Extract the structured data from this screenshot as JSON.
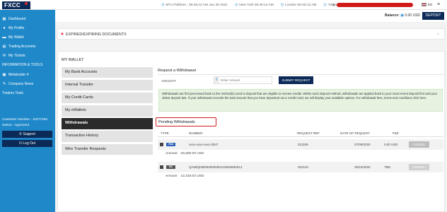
{
  "topbar": {
    "logo": "FXCC",
    "clocks": [
      {
        "label": "MT4 Platform : 06:46:12 AM  Jun 29 2021"
      },
      {
        "label": "New York  06:46:12 AM"
      },
      {
        "label": "London  06:46:12 AM"
      },
      {
        "label": "Tokyo  06:46:12 PM"
      }
    ],
    "user_prefix": "Ji",
    "language": "EN"
  },
  "sidebar": {
    "items": [
      {
        "label": "Dashboard",
        "icon": "dashboard-icon"
      },
      {
        "label": "My Profile",
        "icon": "profile-icon"
      },
      {
        "label": "My Wallet",
        "icon": "wallet-icon"
      },
      {
        "label": "Trading Accounts",
        "icon": "trading-accounts-icon"
      },
      {
        "label": "My Tickets",
        "icon": "tickets-icon"
      }
    ],
    "section_header": "INFORMATION & TOOLS",
    "tools": [
      {
        "label": "Metatrader 4",
        "icon": "metatrader-icon"
      },
      {
        "label": "Company News",
        "icon": "news-icon"
      },
      {
        "label": "Traders Tools",
        "icon": ""
      }
    ],
    "customer_number": "Customer Number :  11077262",
    "status": "Status : Approved",
    "support_label": "Support",
    "logout_label": "Log Out"
  },
  "balance": {
    "label": "Balance:",
    "value": "0.00 USD",
    "deposit_label": "DEPOSIT"
  },
  "expired": {
    "title": "EXPIRED/EXPIRING DOCUMENTS"
  },
  "wallet": {
    "title": "MY WALLET",
    "tabs": [
      {
        "label": "My Bank Accounts",
        "active": false
      },
      {
        "label": "Internal Transfer",
        "active": false
      },
      {
        "label": "My Credit Cards",
        "active": false
      },
      {
        "label": "My eWallets",
        "active": false
      },
      {
        "label": "Withdrawals",
        "active": true
      },
      {
        "label": "Transaction History",
        "active": false
      },
      {
        "label": "Wire Transfer Requests",
        "active": false
      }
    ]
  },
  "withdrawal": {
    "title": "Request a Withdrawal",
    "amount_label": "AMOUNT",
    "amount_placeholder": "Enter Amount",
    "submit_label": "SUBMIT REQUEST",
    "notice": "Withdrawals are first processed back to the method(s) used to deposit that are eligible to receive credits. Within each deposit method, withdrawals are applied back to your most recent deposit first and your oldest deposit last. If your withdrawal exceeds the total amount that you have deposited via a Credit Card, we will display your available options. For withdrawal fees, terms and conditions click here."
  },
  "pending": {
    "title": "Pending Withdrawals",
    "columns": [
      "TYPE",
      "NUMBER",
      "REQUEST REF.",
      "DATE OF REQUEST",
      "FEE"
    ],
    "amount_label": "Amount",
    "rows": [
      {
        "type": "VISA",
        "number": "xxxx-xxxx-xxxx-2947",
        "ref": "021109",
        "date": "07/09/2020",
        "fee": "0.00 USD",
        "cancel": "CANCEL",
        "amount": "26,600.00 USD"
      },
      {
        "type": "MC",
        "number": "QA58QISB00000000012S553600013",
        "ref": "022104",
        "date": "29/10/2020",
        "fee": "TBD",
        "cancel": "CANCEL",
        "amount": "12,318.02 USD"
      }
    ]
  },
  "colors": {
    "sidebar": "#1e88c9",
    "navy": "#0b2a57",
    "active_tab": "#2b2b2b",
    "notice_bg": "#e6f3e1",
    "highlight": "#d01a1a"
  }
}
